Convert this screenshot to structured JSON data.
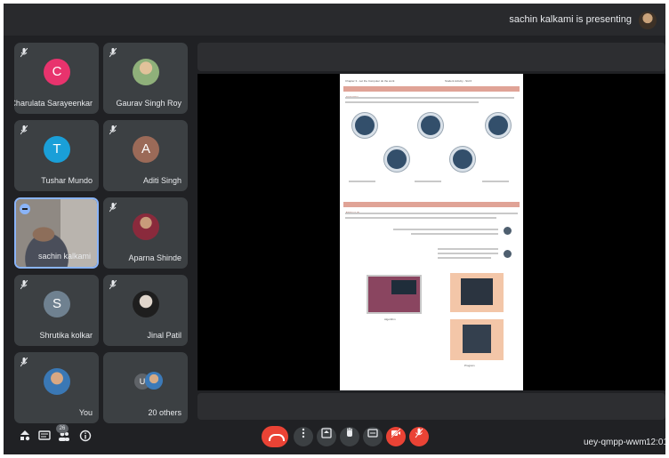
{
  "presenter": {
    "label": "sachin kalkami is presenting"
  },
  "participants": [
    {
      "name": "Charulata Sarayeenkar",
      "initial": "C",
      "color": "#e8336d",
      "kind": "letter"
    },
    {
      "name": "Gaurav Singh Roy",
      "kind": "photo"
    },
    {
      "name": "Tushar Mundo",
      "initial": "T",
      "color": "#1a9fd8",
      "kind": "letter"
    },
    {
      "name": "Aditi Singh",
      "initial": "A",
      "color": "#9b6a58",
      "kind": "letter"
    },
    {
      "name": "sachin kalkami",
      "kind": "video"
    },
    {
      "name": "Aparna Shinde",
      "kind": "photo"
    },
    {
      "name": "Shrutika kolkar",
      "initial": "S",
      "color": "#6f8190",
      "kind": "letter"
    },
    {
      "name": "Jinal Patil",
      "kind": "photo"
    },
    {
      "name": "You",
      "kind": "photo"
    },
    {
      "name": "20 others",
      "initial": "U",
      "kind": "group"
    }
  ],
  "controls": {
    "people_count": "26",
    "meeting_code": "uey-qmpp-wwm",
    "time": "12:01"
  },
  "document": {
    "header_left": "Chapter 3 - Let the Computer do the work",
    "header_right": "Student Activity - Std 6",
    "section1": "Instruction",
    "section2": "Making Life",
    "caption_left": "Algorithm",
    "caption_right": "Program"
  }
}
